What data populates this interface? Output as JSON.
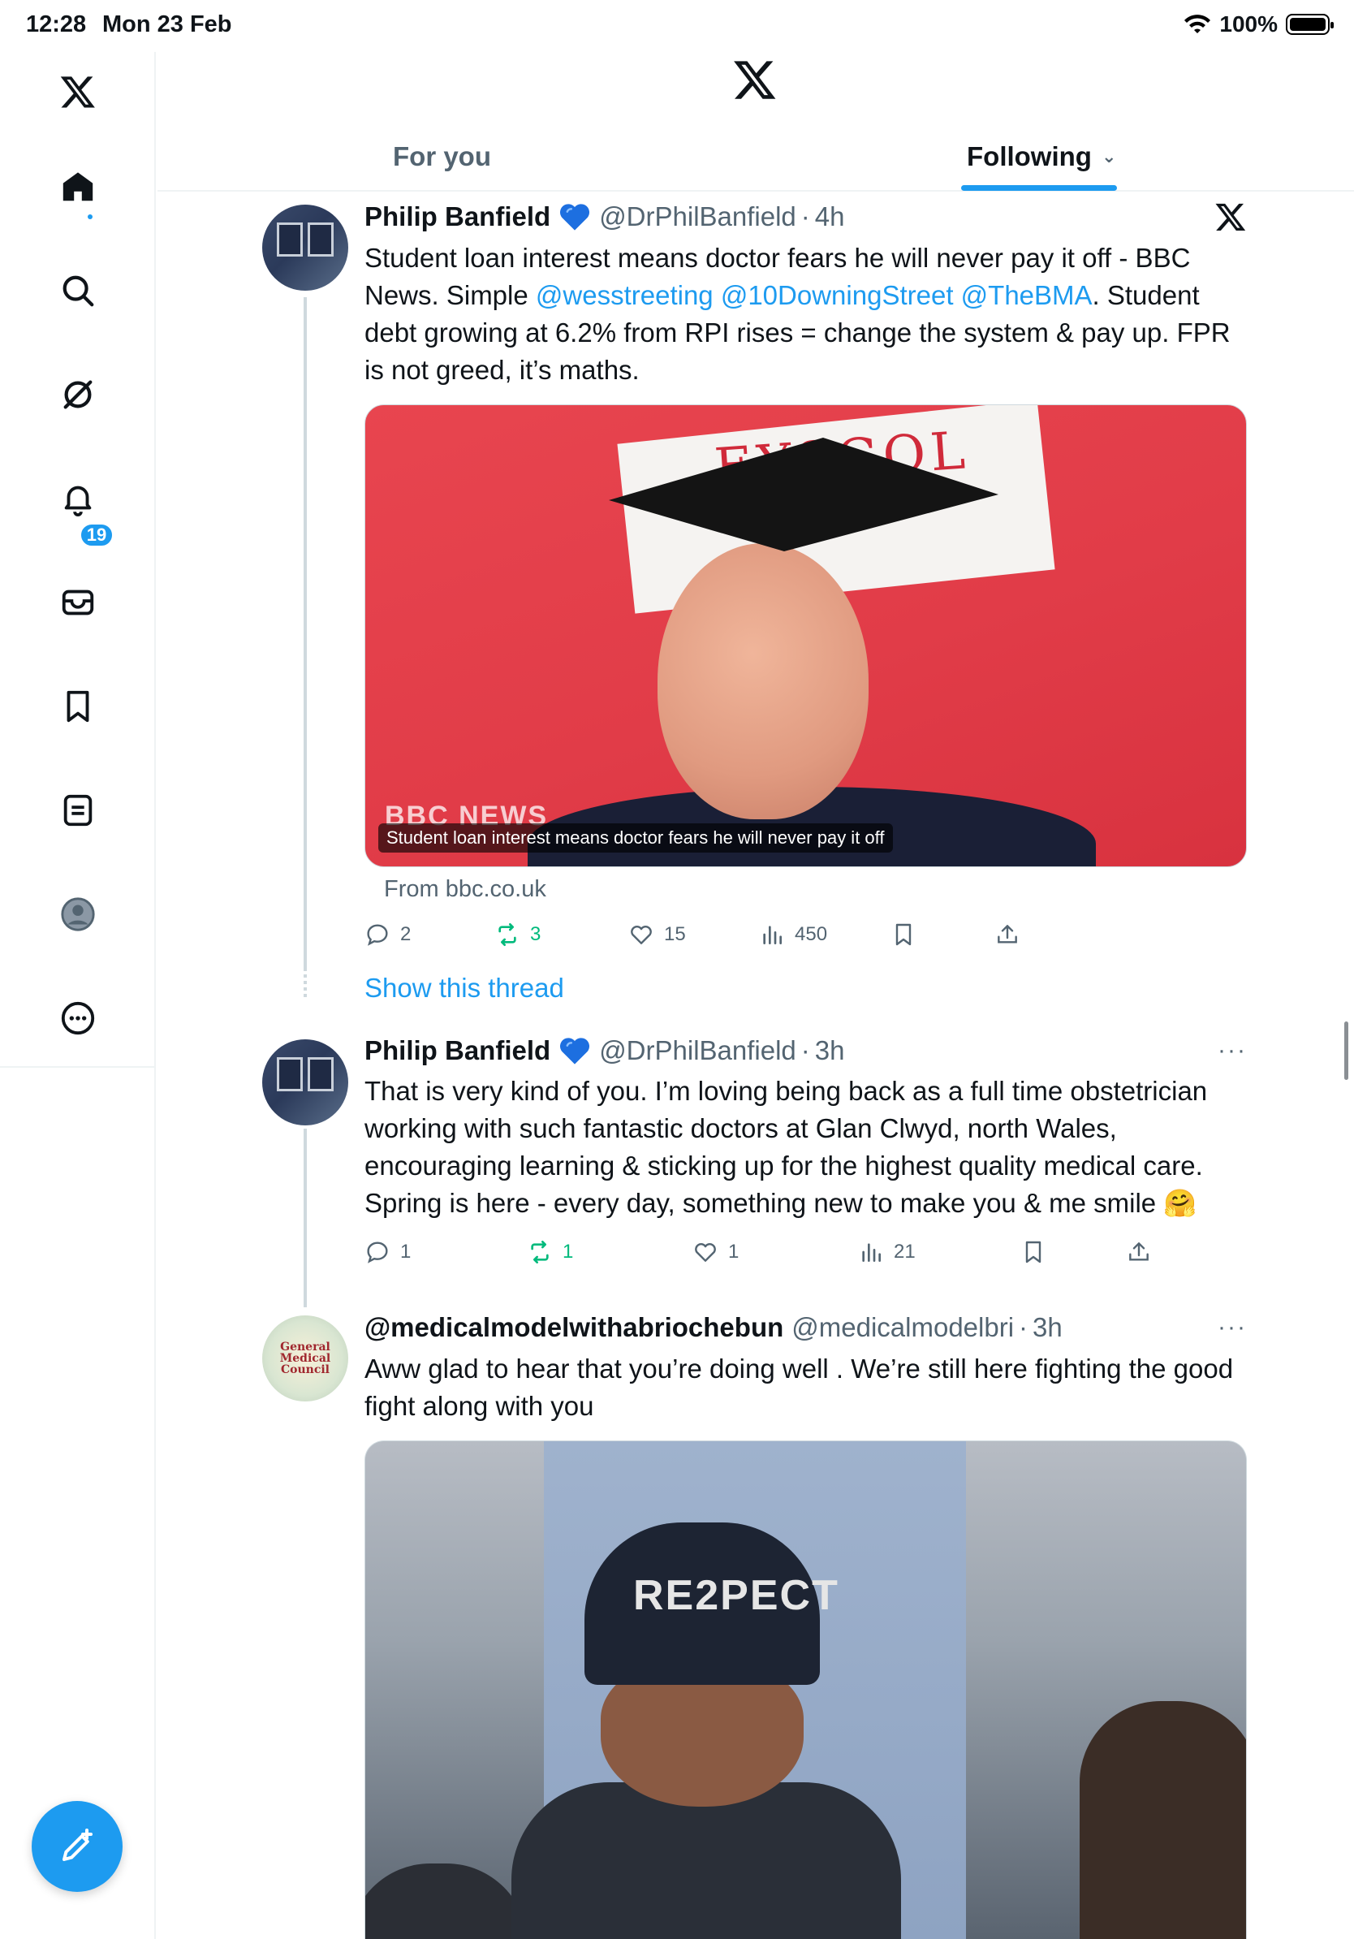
{
  "status_bar": {
    "time": "12:28",
    "date": "Mon 23 Feb",
    "battery_text": "100%"
  },
  "sidebar": {
    "items": [
      {
        "name": "logo",
        "icon": "x-logo-icon"
      },
      {
        "name": "home",
        "icon": "home-icon"
      },
      {
        "name": "explore",
        "icon": "search-icon"
      },
      {
        "name": "grok",
        "icon": "grok-icon"
      },
      {
        "name": "notifications",
        "icon": "bell-icon",
        "badge": "19"
      },
      {
        "name": "messages",
        "icon": "mail-icon"
      },
      {
        "name": "bookmarks",
        "icon": "bookmark-icon"
      },
      {
        "name": "lists",
        "icon": "list-icon"
      },
      {
        "name": "profile",
        "icon": "avatar-icon"
      },
      {
        "name": "more",
        "icon": "more-circle-icon"
      }
    ],
    "compose_icon": "compose-icon"
  },
  "header": {
    "tabs": [
      {
        "label": "For you",
        "selected": false
      },
      {
        "label": "Following",
        "selected": true
      }
    ],
    "accent": "#1d9bf0"
  },
  "tweets": [
    {
      "name": "Philip Banfield",
      "handle": "@DrPhilBanfield",
      "time": "4h",
      "text_parts": [
        "Student loan interest means doctor fears he will never pay it off - BBC News. Simple ",
        "@wesstreeting",
        " ",
        "@10DowningStreet",
        " ",
        "@TheBMA",
        ". Student debt growing at 6.2% from RPI rises = change the system & pay up. FPR is not greed, it’s maths."
      ],
      "card": {
        "caption": "Student loan interest means doctor fears he will never pay it off",
        "overlay_logo": "BBC NEWS",
        "sign_text": "EYSGOL",
        "source": "From bbc.co.uk"
      },
      "stats": {
        "replies": "2",
        "retweets": "3",
        "likes": "15",
        "views": "450"
      },
      "show_thread": "Show this thread"
    },
    {
      "name": "Philip Banfield",
      "handle": "@DrPhilBanfield",
      "time": "3h",
      "text": "That is very kind of you. I’m loving being back as a full time obstetrician working with such fantastic doctors at Glan Clwyd, north Wales, encouraging learning & sticking up for the highest quality medical care. Spring is here - every day, something new to make you & me smile 🤗",
      "stats": {
        "replies": "1",
        "retweets": "1",
        "likes": "1",
        "views": "21"
      }
    },
    {
      "name": "@medicalmodelwithabriochebun",
      "handle": "@medicalmodelbri",
      "time": "3h",
      "text": "Aww glad to hear that you’re doing well . We’re still here fighting the good fight along with you",
      "avatar_text": "General Medical Council",
      "media": {
        "cap_text": "RE2PECT"
      }
    }
  ]
}
